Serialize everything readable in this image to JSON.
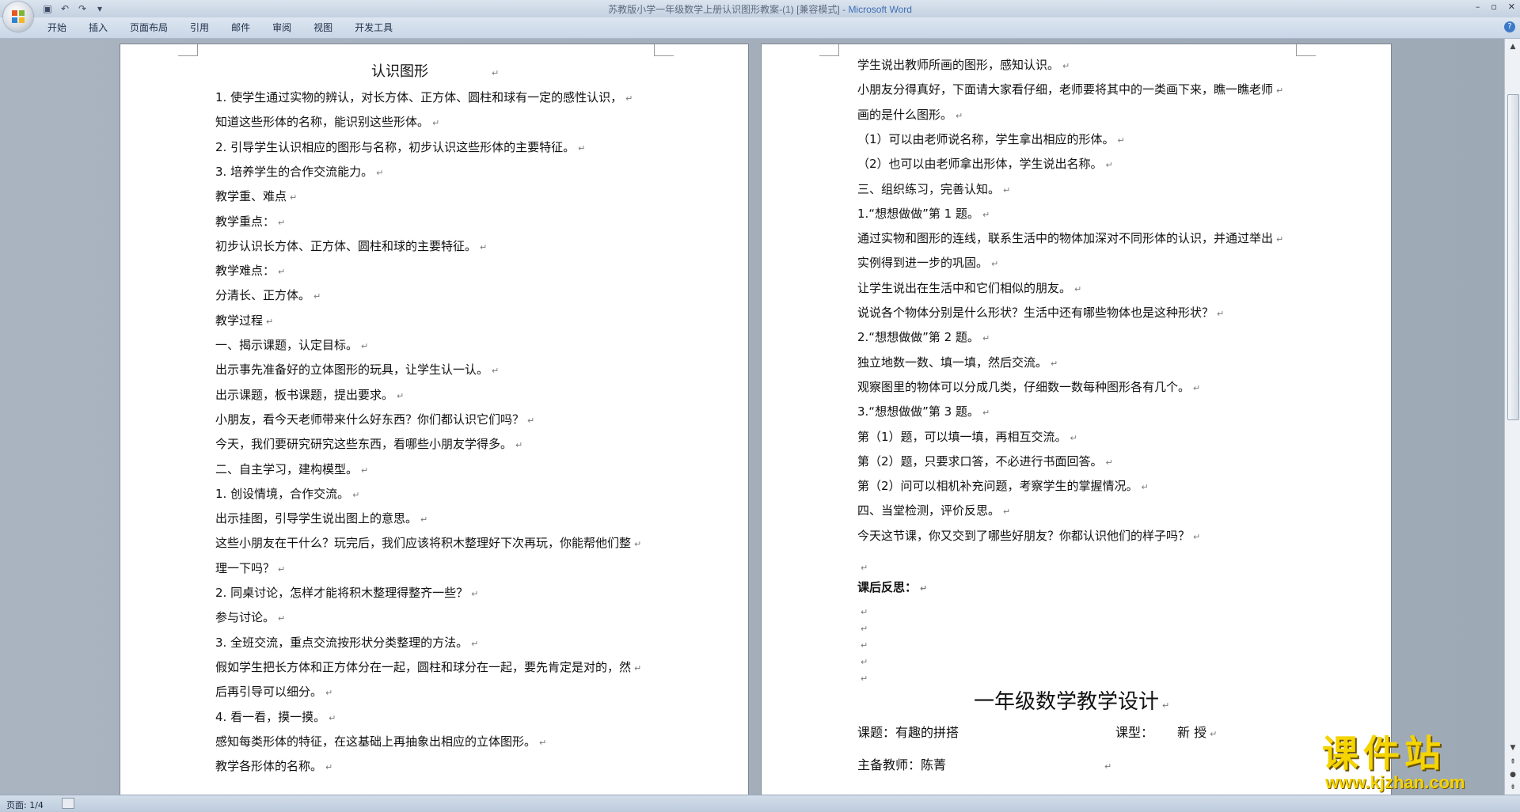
{
  "window": {
    "title": "苏教版小学一年级数学上册认识图形教案-(1) [兼容模式] - ",
    "app_name": "Microsoft Word",
    "controls": [
      "–",
      "▫",
      "✕"
    ]
  },
  "ribbon": {
    "tabs": [
      "开始",
      "插入",
      "页面布局",
      "引用",
      "邮件",
      "审阅",
      "视图",
      "开发工具"
    ]
  },
  "left_page": {
    "title": "认识图形",
    "lines": [
      "1. 使学生通过实物的辨认，对长方体、正方体、圆柱和球有一定的感性认识，",
      "知道这些形体的名称，能识别这些形体。",
      "2. 引导学生认识相应的图形与名称，初步认识这些形体的主要特征。",
      "3. 培养学生的合作交流能力。",
      "教学重、难点",
      "教学重点：",
      "初步认识长方体、正方体、圆柱和球的主要特征。",
      "教学难点：",
      "分清长、正方体。",
      "教学过程",
      "一、揭示课题，认定目标。",
      "出示事先准备好的立体图形的玩具，让学生认一认。",
      "出示课题，板书课题，提出要求。",
      "小朋友，看今天老师带来什么好东西？你们都认识它们吗？",
      "今天，我们要研究研究这些东西，看哪些小朋友学得多。",
      "二、自主学习，建构模型。",
      "1. 创设情境，合作交流。",
      "出示挂图，引导学生说出图上的意思。",
      "这些小朋友在干什么？玩完后，我们应该将积木整理好下次再玩，你能帮他们整",
      "理一下吗？",
      "2. 同桌讨论，怎样才能将积木整理得整齐一些？",
      "参与讨论。",
      "3. 全班交流，重点交流按形状分类整理的方法。",
      "假如学生把长方体和正方体分在一起，圆柱和球分在一起，要先肯定是对的，然",
      "后再引导可以细分。",
      "4. 看一看，摸一摸。",
      "感知每类形体的特征，在这基础上再抽象出相应的立体图形。",
      "教学各形体的名称。"
    ]
  },
  "right_page": {
    "lines": [
      "学生说出教师所画的图形，感知认识。",
      "小朋友分得真好，下面请大家看仔细，老师要将其中的一类画下来，瞧一瞧老师",
      "画的是什么图形。",
      "（1）可以由老师说名称，学生拿出相应的形体。",
      "（2）也可以由老师拿出形体，学生说出名称。",
      "三、组织练习，完善认知。",
      "1.“想想做做”第 1 题。",
      "通过实物和图形的连线，联系生活中的物体加深对不同形体的认识，并通过举出",
      "实例得到进一步的巩固。",
      "让学生说出在生活中和它们相似的朋友。",
      "说说各个物体分别是什么形状？生活中还有哪些物体也是这种形状？",
      "2.“想想做做”第 2 题。",
      "独立地数一数、填一填，然后交流。",
      "观察图里的物体可以分成几类，仔细数一数每种图形各有几个。",
      "3.“想想做做”第 3 题。",
      "第（1）题，可以填一填，再相互交流。",
      "第（2）题，只要求口答，不必进行书面回答。",
      "第（2）问可以相机补充问题，考察学生的掌握情况。",
      "四、当堂检测，评价反思。",
      "今天这节课，你又交到了哪些好朋友？你都认识他们的样子吗？",
      "",
      "课后反思：",
      "",
      "",
      "",
      "",
      ""
    ],
    "heading2": "一年级数学教学设计",
    "subject_label": "课题：有趣的拼搭",
    "type_label": "课型：",
    "type_value": "新 授",
    "teacher_label": "主备教师：陈菁"
  },
  "status": {
    "page": "页面: 1/4"
  },
  "watermark": {
    "title": "课件站",
    "url": "www.kjzhan.com"
  },
  "paragraph_mark": "↵"
}
